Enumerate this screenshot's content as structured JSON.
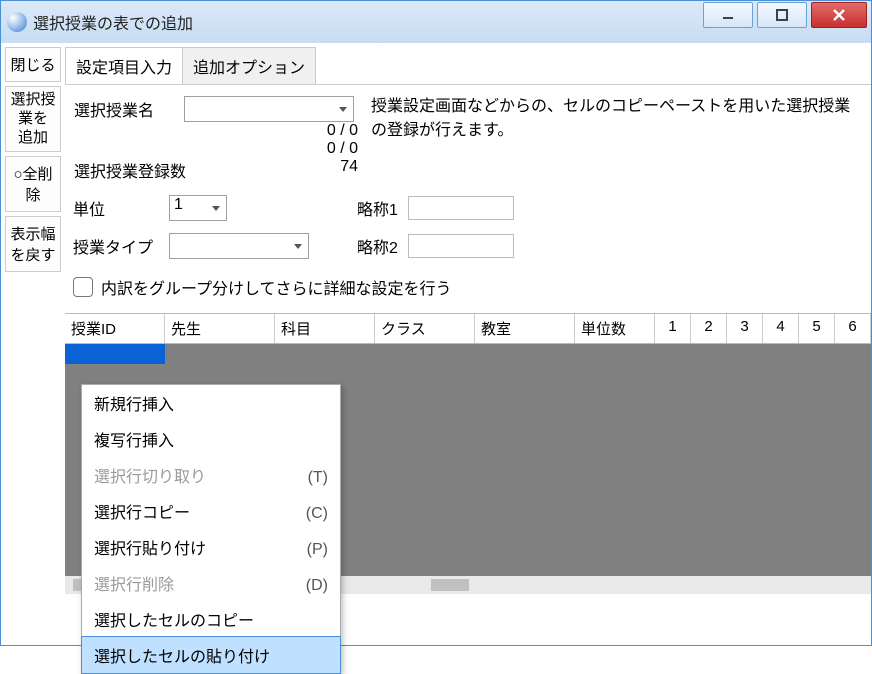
{
  "window": {
    "title": "選択授業の表での追加"
  },
  "sidebar": {
    "close": "閉じる",
    "add_elective_line1": "選択授業を",
    "add_elective_line2": "追加",
    "delete_all": "○全削除",
    "reset_width": "表示幅を戻す"
  },
  "tabs": {
    "settings": "設定項目入力",
    "options": "追加オプション"
  },
  "form": {
    "name_label": "選択授業名",
    "ratio1": "0 / 0",
    "ratio2": "0 / 0",
    "count_label": "選択授業登録数",
    "count_value": "74",
    "unit_label": "単位",
    "unit_value": "1",
    "type_label": "授業タイプ",
    "abbr1_label": "略称1",
    "abbr2_label": "略称2",
    "group_checkbox": "内訳をグループ分けしてさらに詳細な設定を行う"
  },
  "description": "授業設定画面などからの、セルのコピーペーストを用いた選択授業の登録が行えます。",
  "grid": {
    "columns": {
      "id": "授業ID",
      "teacher": "先生",
      "subject": "科目",
      "class": "クラス",
      "room": "教室",
      "credits": "単位数",
      "n1": "1",
      "n2": "2",
      "n3": "3",
      "n4": "4",
      "n5": "5",
      "n6": "6"
    }
  },
  "context_menu": {
    "new_row": "新規行挿入",
    "copy_row_insert": "複写行挿入",
    "cut_row": "選択行切り取り",
    "cut_row_acc": "(T)",
    "copy_row": "選択行コピー",
    "copy_row_acc": "(C)",
    "paste_row": "選択行貼り付け",
    "paste_row_acc": "(P)",
    "delete_row": "選択行削除",
    "delete_row_acc": "(D)",
    "copy_cell": "選択したセルのコピー",
    "paste_cell": "選択したセルの貼り付け"
  }
}
